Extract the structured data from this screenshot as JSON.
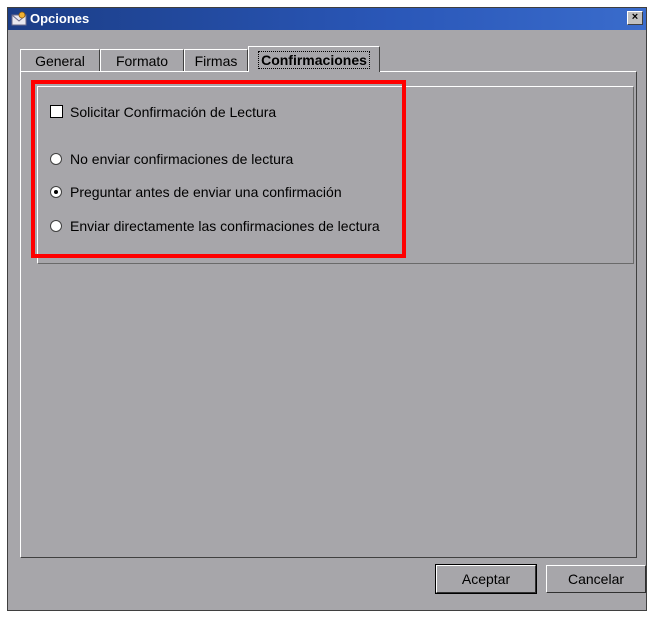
{
  "window": {
    "title": "Opciones",
    "close_label": "×"
  },
  "tabs": [
    {
      "label": "General",
      "active": false
    },
    {
      "label": "Formato",
      "active": false
    },
    {
      "label": "Firmas",
      "active": false
    },
    {
      "label": "Confirmaciones",
      "active": true
    }
  ],
  "confirmations": {
    "request_receipt_label": "Solicitar Confirmación de Lectura",
    "request_receipt_checked": false,
    "options": [
      {
        "label": "No enviar confirmaciones de lectura",
        "selected": false
      },
      {
        "label": "Preguntar antes de enviar una confirmación",
        "selected": true
      },
      {
        "label": "Enviar directamente las confirmaciones de lectura",
        "selected": false
      }
    ]
  },
  "buttons": {
    "ok": "Aceptar",
    "cancel": "Cancelar"
  },
  "colors": {
    "highlight": "#ff0000",
    "title_bar": "#1b3d86",
    "dialog_bg": "#a7a6aa"
  },
  "icons": {
    "title": "mail-envelope-icon"
  }
}
